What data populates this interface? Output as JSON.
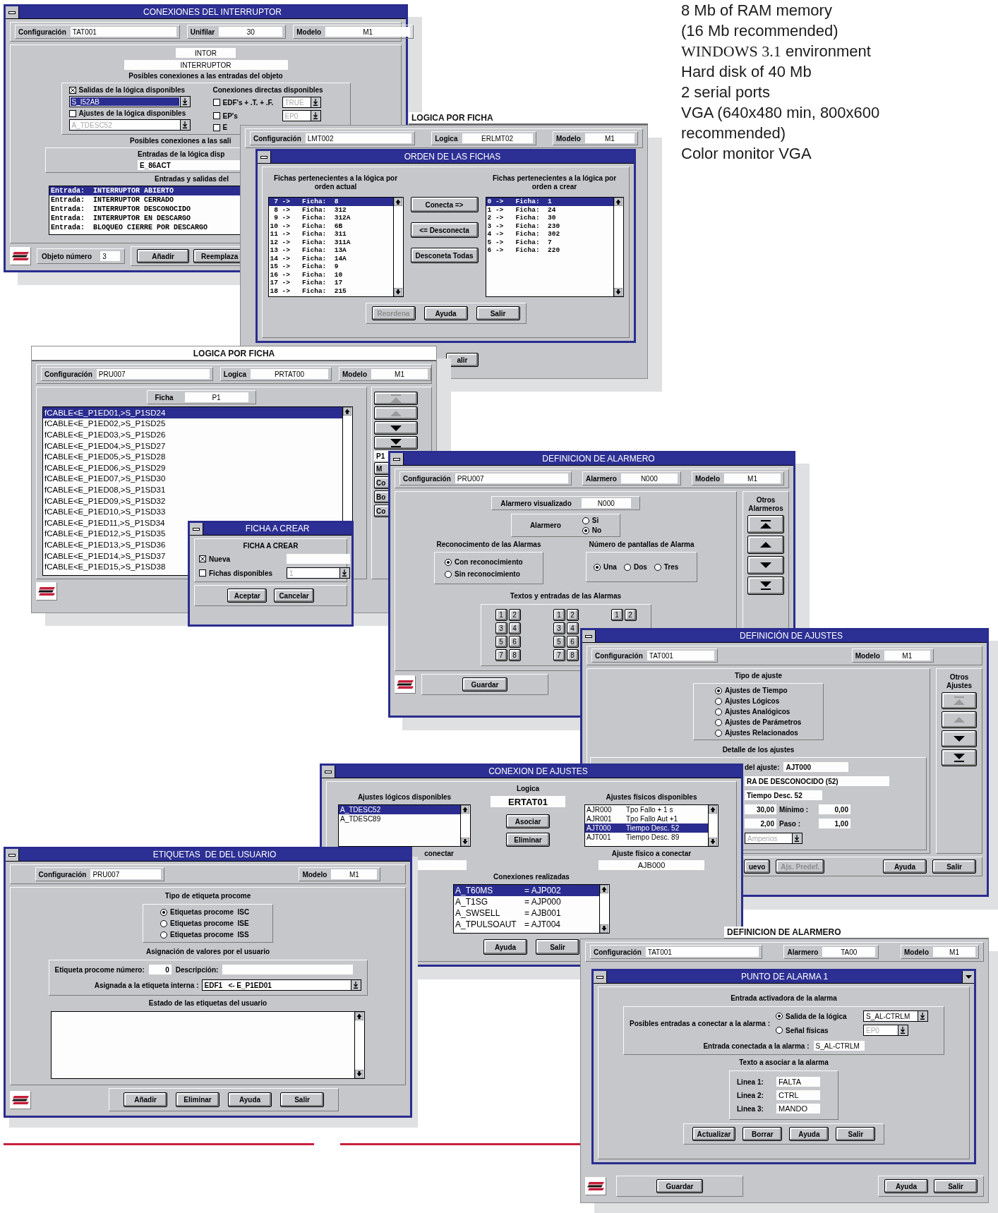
{
  "spec_lines": [
    {
      "text": "8 Mb of RAM memory"
    },
    {
      "text": "(16 Mb recommended)"
    },
    {
      "lead": "WINDOWS 3.1",
      "text": "environment"
    },
    {
      "text": "Hard disk of 40 Mb"
    },
    {
      "text": "2 serial ports"
    },
    {
      "text": "VGA (640x480 min, 800x600"
    },
    {
      "text": "recommended)"
    },
    {
      "text": "Color monitor VGA"
    }
  ],
  "interruptor": {
    "title": "CONEXIONES DEL INTERRUPTOR",
    "header": [
      {
        "label": "Configuración",
        "value": "TAT001"
      },
      {
        "label": "Unifilar",
        "value": "30"
      },
      {
        "label": "Modelo",
        "value": "M1"
      }
    ],
    "code": "INTOR",
    "name": "INTERRUPTOR",
    "inputs_title": "Posibles conexiones a las entradas del objeto",
    "logic_outputs": {
      "label": "Salidas de la lógica disponibles",
      "checked": true,
      "value": "S_I52AB",
      "highlighted": true,
      "disabled": false
    },
    "logic_settings": {
      "label": "Ajustes de la lógica disponibles",
      "checked": false,
      "value": "A_TDESC52",
      "highlighted": false,
      "disabled": true
    },
    "direct_title": "Conexiones directas disponibles",
    "direct": [
      {
        "label": "EDF's + .T. + .F.",
        "checked": false,
        "value": "TRUE",
        "disabled": true
      },
      {
        "label": "EP's",
        "checked": false,
        "value": "EP0",
        "disabled": true
      },
      {
        "label": "E",
        "checked": false
      }
    ],
    "outputs_title": "Posibles conexiones a las sali",
    "inputs_label": "Entradas de la lógica disp",
    "inputs_value": "E_86ACT",
    "io_title": "Entradas y salidas del",
    "io_rows": [
      {
        "text": "Entrada:  INTERRUPTOR ABIERTO",
        "selected": true
      },
      {
        "text": "Entrada:  INTERRUPTOR CERRADO",
        "selected": false
      },
      {
        "text": "Entrada:  INTERRUPTOR DESCONOCIDO",
        "selected": false
      },
      {
        "text": "Entrada:  INTERRUPTOR EN DESCARGO",
        "selected": false
      },
      {
        "text": "Entrada:  BLOQUEO CIERRE POR DESCARGO",
        "selected": false
      }
    ],
    "number_label": "Objeto número",
    "number": "3",
    "buttons": [
      "Añadir",
      "Reemplaza"
    ]
  },
  "logica_lmt": {
    "title": "LOGICA POR FICHA",
    "header": [
      {
        "label": "Configuración",
        "value": "LMT002"
      },
      {
        "label": "Logica",
        "value": "ERLMT02"
      },
      {
        "label": "Modelo",
        "value": "M1"
      }
    ],
    "button": "alir"
  },
  "orden": {
    "title": "ORDEN DE LAS FICHAS",
    "current_title": "Fichas pertenecientes a la lógica por orden actual",
    "current": [
      {
        "text": " 7 ->   Ficha:  8",
        "selected": true
      },
      {
        "text": " 8 ->   Ficha:  312",
        "selected": false
      },
      {
        "text": " 9 ->   Ficha:  312A",
        "selected": false
      },
      {
        "text": "10 ->   Ficha:  6B",
        "selected": false
      },
      {
        "text": "11 ->   Ficha:  311",
        "selected": false
      },
      {
        "text": "12 ->   Ficha:  311A",
        "selected": false
      },
      {
        "text": "13 ->   Ficha:  13A",
        "selected": false
      },
      {
        "text": "14 ->   Ficha:  14A",
        "selected": false
      },
      {
        "text": "15 ->   Ficha:  9",
        "selected": false
      },
      {
        "text": "16 ->   Ficha:  10",
        "selected": false
      },
      {
        "text": "17 ->   Ficha:  17",
        "selected": false
      },
      {
        "text": "18 ->   Ficha:  215",
        "selected": false
      }
    ],
    "target_title": "Fichas pertenecientes a la lógica por orden a crear",
    "target": [
      {
        "text": "0 ->   Ficha:  1",
        "selected": true
      },
      {
        "text": "1 ->   Ficha:  24",
        "selected": false
      },
      {
        "text": "2 ->   Ficha:  30",
        "selected": false
      },
      {
        "text": "3 ->   Ficha:  230",
        "selected": false
      },
      {
        "text": "4 ->   Ficha:  302",
        "selected": false
      },
      {
        "text": "5 ->   Ficha:  7",
        "selected": false
      },
      {
        "text": "6 ->   Ficha:  220",
        "selected": false
      }
    ],
    "actions": [
      "Conecta =>",
      "<= Desconecta",
      "Desconeta Todas"
    ],
    "buttons": [
      {
        "label": "Reordena",
        "disabled": true
      },
      {
        "label": "Ayuda",
        "disabled": false
      },
      {
        "label": "Salir",
        "disabled": false
      }
    ]
  },
  "logica_pru": {
    "title": "LOGICA POR FICHA",
    "header": [
      {
        "label": "Configuración",
        "value": "PRU007"
      },
      {
        "label": "Logica",
        "value": "PRTAT00"
      },
      {
        "label": "Modelo",
        "value": "M1"
      }
    ],
    "ficha_label": "Ficha",
    "ficha_value": "P1",
    "rows": [
      {
        "text": "fCABLE<E_P1ED01,>S_P1SD24",
        "selected": true
      },
      {
        "text": "fCABLE<E_P1ED02,>S_P1SD25",
        "selected": false
      },
      {
        "text": "fCABLE<E_P1ED03,>S_P1SD26",
        "selected": false
      },
      {
        "text": "fCABLE<E_P1ED04,>S_P1SD27",
        "selected": false
      },
      {
        "text": "fCABLE<E_P1ED05,>S_P1SD28",
        "selected": false
      },
      {
        "text": "fCABLE<E_P1ED06,>S_P1SD29",
        "selected": false
      },
      {
        "text": "fCABLE<E_P1ED07,>S_P1SD30",
        "selected": false
      },
      {
        "text": "fCABLE<E_P1ED08,>S_P1SD31",
        "selected": false
      },
      {
        "text": "fCABLE<E_P1ED09,>S_P1SD32",
        "selected": false
      },
      {
        "text": "fCABLE<E_P1ED10,>S_P1SD33",
        "selected": false
      },
      {
        "text": "fCABLE<E_P1ED11,>S_P1SD34",
        "selected": false
      },
      {
        "text": "fCABLE<E_P1ED12,>S_P1SD35",
        "selected": false
      },
      {
        "text": "fCABLE<E_P1ED13,>S_P1SD36",
        "selected": false
      },
      {
        "text": "fCABLE<E_P1ED14,>S_P1SD37",
        "selected": false
      },
      {
        "text": "fCABLE<E_P1ED15,>S_P1SD38",
        "selected": false
      }
    ],
    "nav": [
      {
        "kind": "first",
        "disabled": true
      },
      {
        "kind": "up",
        "disabled": true
      },
      {
        "kind": "down",
        "disabled": false
      },
      {
        "kind": "last",
        "disabled": false
      }
    ],
    "side_field": "P1",
    "side_buttons": [
      "M",
      "Co",
      "Bo",
      "Co"
    ]
  },
  "ficha_crear": {
    "title": "FICHA A CREAR",
    "heading": "FICHA A CREAR",
    "new": {
      "label": "Nueva",
      "checked": true
    },
    "available": {
      "label": "Fichas disponibles",
      "checked": false,
      "value": "1",
      "disabled": true
    },
    "buttons": [
      "Aceptar",
      "Cancelar"
    ]
  },
  "alarmero": {
    "title": "DEFINICION DE ALARMERO",
    "header": [
      {
        "label": "Configuración",
        "value": "PRU007"
      },
      {
        "label": "Alarmero",
        "value": "N000"
      },
      {
        "label": "Modelo",
        "value": "M1"
      }
    ],
    "shown_label": "Alarmero visualizado",
    "shown_value": "N000",
    "alarm_label": "Alarmero",
    "alarm_options": [
      {
        "label": "Si",
        "selected": false
      },
      {
        "label": "No",
        "selected": true
      }
    ],
    "ack_title": "Reconocimento de las Alarmas",
    "ack_options": [
      {
        "label": "Con reconocimiento",
        "selected": true
      },
      {
        "label": "Sin reconocimiento",
        "selected": false
      }
    ],
    "screens_title": "Número de pantallas de Alarma",
    "screens_options": [
      {
        "label": "Una",
        "selected": true
      },
      {
        "label": "Dos",
        "selected": false
      },
      {
        "label": "Tres",
        "selected": false
      }
    ],
    "texts_title": "Textos y entradas de las Alarmas",
    "keypads": [
      [
        "1",
        "2",
        "3",
        "4",
        "5",
        "6",
        "7",
        "8"
      ],
      [
        "1",
        "2",
        "3",
        "4",
        "5",
        "6",
        "7",
        "8"
      ],
      [
        "1",
        "2"
      ]
    ],
    "others_title": "Otros Alarmeros",
    "nav": [
      {
        "kind": "first",
        "disabled": false
      },
      {
        "kind": "up",
        "disabled": false
      },
      {
        "kind": "down",
        "disabled": false
      },
      {
        "kind": "last",
        "disabled": false
      }
    ],
    "button": "Guardar"
  },
  "ajustes": {
    "title": "DEFINICIÓN DE AJUSTES",
    "header": [
      {
        "label": "Configuración",
        "value": "TAT001"
      },
      {
        "label": "Modelo",
        "value": "M1"
      }
    ],
    "type_title": "Tipo de ajuste",
    "types": [
      {
        "label": "Ajustes de Tiempo",
        "selected": true
      },
      {
        "label": "Ajustes Lógicos",
        "selected": false
      },
      {
        "label": "Ajustes Analógicos",
        "selected": false
      },
      {
        "label": "Ajustes de Parámetros",
        "selected": false
      },
      {
        "label": "Ajustes Relacionados",
        "selected": false
      }
    ],
    "detail_title": "Detalle de los ajustes",
    "setting_label": "del ajuste:",
    "setting_value": "AJT000",
    "name_value": "RA DE DESCONOCIDO (52)",
    "desc_value": "Tiempo Desc. 52",
    "range": [
      {
        "value": "30,00",
        "label": "Mínimo :",
        "limit": "0,00"
      },
      {
        "value": "2,00",
        "label": "Paso :",
        "limit": "1,00"
      }
    ],
    "unit": {
      "value": "Amperios",
      "disabled": true
    },
    "others_title": "Otros Ajustes",
    "nav": [
      {
        "kind": "first",
        "disabled": true
      },
      {
        "kind": "up",
        "disabled": true
      },
      {
        "kind": "down",
        "disabled": false
      },
      {
        "kind": "last",
        "disabled": false
      }
    ],
    "buttons": [
      {
        "label": "uevo",
        "disabled": false
      },
      {
        "label": "Ajs. Predef.",
        "disabled": true
      },
      {
        "label": "Ayuda",
        "disabled": false
      },
      {
        "label": "Salir",
        "disabled": false
      }
    ]
  },
  "conexion": {
    "title": "CONEXION DE AJUSTES",
    "logical_title": "Ajustes lógicos disponibles",
    "logical": [
      {
        "text": "A_TDESC52",
        "selected": true
      },
      {
        "text": "A_TDESC89",
        "selected": false
      }
    ],
    "logic_label": "Logica",
    "logic_value": "ERTAT01",
    "actions": [
      "Asociar",
      "Eliminar"
    ],
    "physical_title": "Ajustes físicos disponibles",
    "physical": [
      {
        "code": "AJR000",
        "text": "Tpo Fallo + 1 s",
        "selected": false
      },
      {
        "code": "AJR001",
        "text": "Tpo Fallo Aut +1",
        "selected": false
      },
      {
        "code": "AJT000",
        "text": "Tiempo Desc. 52",
        "selected": true
      },
      {
        "code": "AJT001",
        "text": "Tiempo Desc. 89",
        "selected": false
      }
    ],
    "logical_connect_label": "conectar",
    "physical_connect_label": "Ajuste físico a conectar",
    "physical_connect_value": "AJB000",
    "connections_title": "Conexiones realizadas",
    "connections": [
      {
        "logical": "A_T60MS",
        "physical": "= AJP002",
        "selected": true
      },
      {
        "logical": "A_T1SG",
        "physical": "= AJP000",
        "selected": false
      },
      {
        "logical": "A_SWSELL",
        "physical": "= AJB001",
        "selected": false
      },
      {
        "logical": "A_TPULSOAUT",
        "physical": "= AJT004",
        "selected": false
      }
    ],
    "buttons": [
      "Ayuda",
      "Salir"
    ]
  },
  "etiquetas": {
    "title": "ETIQUETAS  DE DEL USUARIO",
    "header": [
      {
        "label": "Configuración",
        "value": "PRU007"
      },
      {
        "label": "Modelo",
        "value": "M1"
      }
    ],
    "type_title": "Tipo de etiqueta procome",
    "types": [
      {
        "label": "Etiquetas procome  ISC",
        "selected": true
      },
      {
        "label": "Etiquetas procome  ISE",
        "selected": false
      },
      {
        "label": "Etiquetas procome  ISS",
        "selected": false
      }
    ],
    "assign_title": "Asignación de valores por el usuario",
    "number_label": "Etiqueta procome número:",
    "number": "0",
    "description_label": "Descripción:",
    "internal_label": "Asignada a la etiqueta interna :",
    "internal_value": "EDF1   <- E_P1ED01",
    "status_title": "Estado de las etiquetas del usuario",
    "buttons": [
      "Añadir",
      "Eliminar",
      "Ayuda",
      "Salir"
    ]
  },
  "alarmero_ta": {
    "title": "DEFINICION DE ALARMERO",
    "header": [
      {
        "label": "Configuración",
        "value": "TAT001"
      },
      {
        "label": "Alarmero",
        "value": "TA00"
      },
      {
        "label": "Modelo",
        "value": "M1"
      }
    ],
    "buttons": [
      "Guardar",
      "Ayuda",
      "Salir"
    ]
  },
  "punto_alarma": {
    "title": "PUNTO DE ALARMA 1",
    "trigger_title": "Entrada activadora de la alarma",
    "possible_label": "Posibles entradas a conectar a la alarma :",
    "sources": [
      {
        "label": "Salida de la lógica",
        "selected": true,
        "value": "S_AL-CTRLM",
        "disabled": false
      },
      {
        "label": "Señal físicas",
        "selected": false,
        "value": "EP0",
        "disabled": true
      }
    ],
    "connected_label": "Entrada conectada a la alarma :",
    "connected_value": "S_AL-CTRLM",
    "text_title": "Texto a asociar a la alarma",
    "lines": [
      {
        "label": "Linea 1:",
        "value": "FALTA"
      },
      {
        "label": "Linea 2:",
        "value": "CTRL"
      },
      {
        "label": "Linea 3:",
        "value": "MANDO"
      }
    ],
    "buttons": [
      "Actualizar",
      "Borrar",
      "Ayuda",
      "Salir"
    ]
  }
}
